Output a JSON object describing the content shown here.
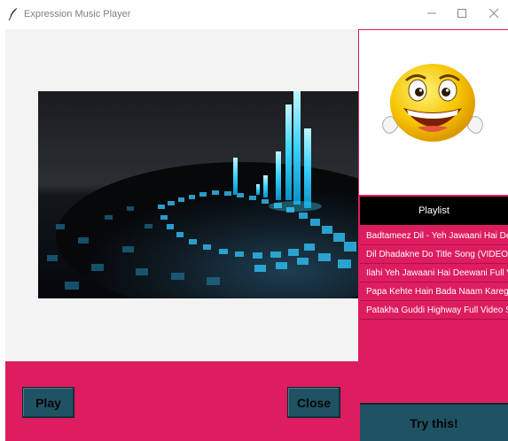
{
  "window": {
    "title": "Expression Music Player",
    "icon": "feather-icon",
    "controls": [
      "minimize-icon",
      "maximize-icon",
      "close-icon"
    ]
  },
  "player": {
    "play_label": "Play",
    "close_label": "Close"
  },
  "sidebar": {
    "emoji": "smiley-face-icon",
    "playlist_header": "Playlist",
    "playlist_items": [
      "Badtameez Dil - Yeh Jawaani Hai Deewani",
      "Dil Dhadakne Do Title Song (VIDEO)",
      "Ilahi Yeh Jawaani Hai Deewani Full Video",
      "Papa Kehte Hain Bada Naam Karega",
      "Patakha Guddi Highway Full Video Song"
    ],
    "try_label": "Try this!"
  },
  "colors": {
    "accent": "#dd1d5f",
    "button": "#1f5363",
    "visualizer": "#2fd6ff"
  }
}
